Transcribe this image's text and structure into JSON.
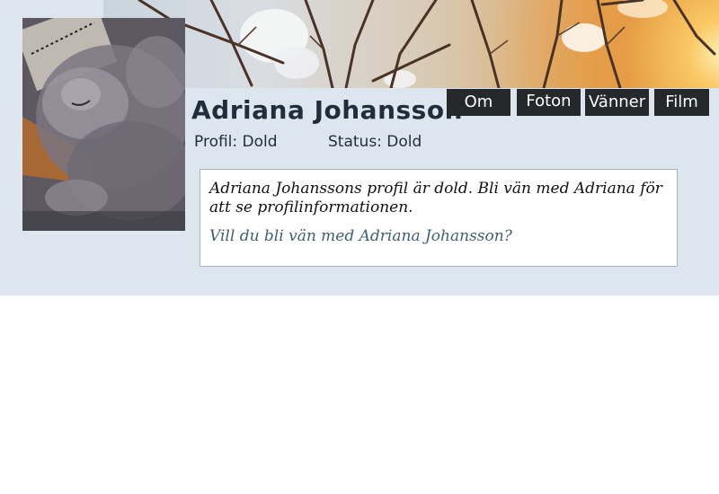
{
  "profile": {
    "name": "Adriana Johansson",
    "profile_label": "Profil: Dold",
    "status_label": "Status: Dold"
  },
  "tabs": [
    {
      "label": "Om"
    },
    {
      "label": "Foton"
    },
    {
      "label": "Vänner"
    },
    {
      "label": "Film"
    }
  ],
  "notice": {
    "message": "Adriana Johanssons profil är dold. Bli vän med Adriana för att se profilinformationen.",
    "friend_link": "Vill du bli vän med Adriana Johansson?"
  },
  "colors": {
    "panel_background": "#dde6ee",
    "tab_background": "#25292c",
    "name_color": "#1f2d3d",
    "link_color": "#3e5f74"
  }
}
